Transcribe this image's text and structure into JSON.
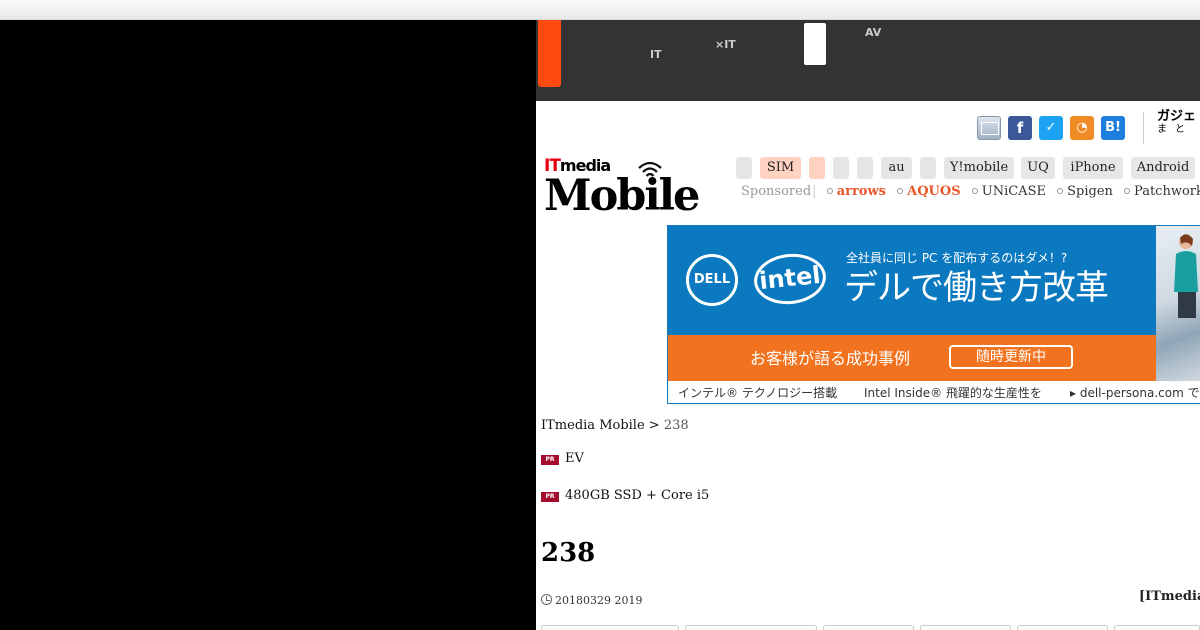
{
  "global_nav": {
    "item1_line1": "　　",
    "item1_line2": "IT",
    "item2_line1": "　　　",
    "item2_line2": "×IT",
    "item3_line1": "AV",
    "item3_line2": "　　"
  },
  "share": {
    "fb": "f",
    "tw": "✓",
    "rss": "◔",
    "hb": "B!"
  },
  "gadget": {
    "line1": "ガジェ",
    "line2": "まと"
  },
  "brand": {
    "it": "IT",
    "media": "media",
    "mobile": "Mobile"
  },
  "categories": [
    "",
    "SIM",
    "",
    "",
    "",
    "au",
    "",
    "Y!mobile",
    "UQ",
    "iPhone",
    "Android"
  ],
  "sponsored": {
    "label": "Sponsored",
    "items": [
      "arrows",
      "AQUOS",
      "UNiCASE",
      "Spigen",
      "Patchworks"
    ]
  },
  "ad": {
    "dell": "DELL",
    "intel": "intel",
    "headline_small": "全社員に同じ PC を配布するのはダメ！?",
    "headline_big": "デルで働き方改革",
    "case_text": "お客様が語る成功事例",
    "button": "随時更新中",
    "footer1": "インテル® テクノロジー搭載",
    "footer2": "Intel Inside® 飛躍的な生産性を",
    "footer3": "▸ dell-persona.com で"
  },
  "breadcrumb": {
    "root": "ITmedia Mobile",
    "sep": " > ",
    "current": "238"
  },
  "pr": {
    "badge": "PR",
    "line1": "EV",
    "line2": "480GB SSD + Core i5"
  },
  "article": {
    "title": "238",
    "date": "20180329 2019",
    "source": "[ITmedia"
  }
}
